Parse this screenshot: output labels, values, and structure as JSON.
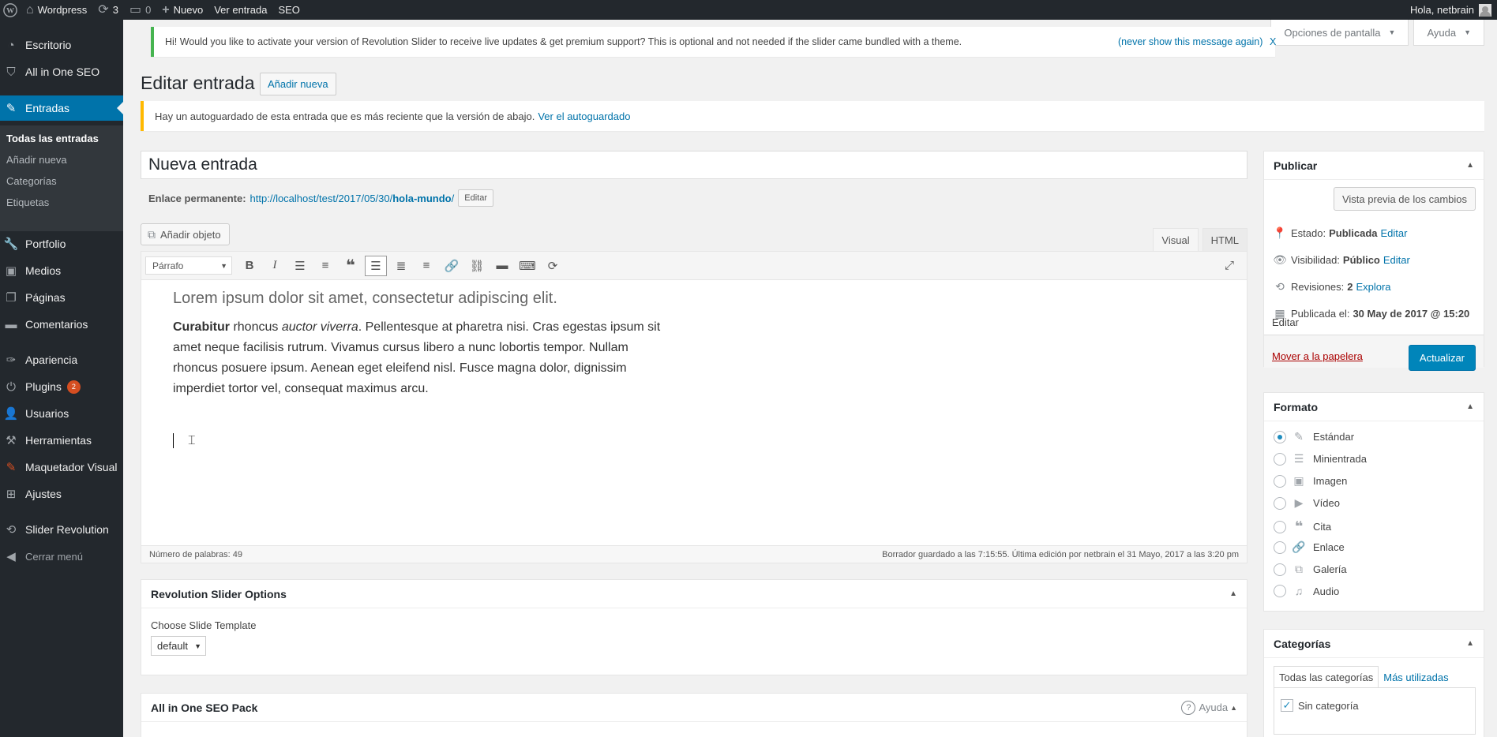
{
  "adminbar": {
    "site_name": "Wordpress",
    "updates_count": "3",
    "comments_count": "0",
    "new_label": "Nuevo",
    "view_post": "Ver entrada",
    "seo": "SEO",
    "greeting": "Hola, netbrain"
  },
  "sidebar": {
    "items": [
      {
        "label": "Escritorio",
        "icon": "dashboard-icon"
      },
      {
        "label": "All in One SEO",
        "icon": "shield-icon"
      },
      {
        "label": "Entradas",
        "icon": "pin-icon"
      },
      {
        "label": "Portfolio",
        "icon": "wrench-icon"
      },
      {
        "label": "Medios",
        "icon": "media-icon"
      },
      {
        "label": "Páginas",
        "icon": "pages-icon"
      },
      {
        "label": "Comentarios",
        "icon": "comment-icon"
      },
      {
        "label": "Apariencia",
        "icon": "brush-icon"
      },
      {
        "label": "Plugins",
        "icon": "plugin-icon",
        "badge": "2"
      },
      {
        "label": "Usuarios",
        "icon": "users-icon"
      },
      {
        "label": "Herramientas",
        "icon": "tools-icon"
      },
      {
        "label": "Maquetador Visual",
        "icon": "builder-icon"
      },
      {
        "label": "Ajustes",
        "icon": "settings-icon"
      },
      {
        "label": "Slider Revolution",
        "icon": "refresh-icon"
      },
      {
        "label": "Cerrar menú",
        "icon": "collapse-icon"
      }
    ],
    "submenu": [
      "Todas las entradas",
      "Añadir nueva",
      "Categorías",
      "Etiquetas"
    ]
  },
  "screen_meta": {
    "options": "Opciones de pantalla",
    "help": "Ayuda"
  },
  "notices": {
    "revslider": "Hi! Would you like to activate your version of Revolution Slider to receive live updates & get premium support? This is optional and not needed if the slider came bundled with a theme.",
    "revslider_dismiss": "(never show this message again)",
    "revslider_x": "X",
    "autosave": "Hay un autoguardado de esta entrada que es más reciente que la versión de abajo.",
    "autosave_link": "Ver el autoguardado"
  },
  "page": {
    "title": "Editar entrada",
    "add_new": "Añadir nueva"
  },
  "post": {
    "title": "Nueva entrada",
    "permalink_label": "Enlace permanente:",
    "permalink_base": "http://localhost/test/2017/05/30/",
    "permalink_slug": "hola-mundo",
    "permalink_end": "/",
    "permalink_edit": "Editar"
  },
  "editor": {
    "add_media": "Añadir objeto",
    "tab_visual": "Visual",
    "tab_html": "HTML",
    "format_value": "Párrafo",
    "heading": "Lorem ipsum dolor sit amet, consectetur adipiscing elit.",
    "para_bold": "Curabitur",
    "para_1": " rhoncus ",
    "para_italic": "auctor viverra",
    "para_2": ". Pellentesque at pharetra nisi. Cras egestas ipsum sit amet neque facilisis rutrum. Vivamus cursus libero a nunc lobortis tempor. Nullam rhoncus posuere ipsum. Aenean eget eleifend nisl. Fusce magna dolor, dignissim imperdiet tortor vel, consequat maximus arcu.",
    "word_count": "Número de palabras: 49",
    "autosave_status": "Borrador guardado a las 7:15:55. Última edición por netbrain el 31 Mayo, 2017 a las 3:20 pm"
  },
  "rev_options": {
    "title": "Revolution Slider Options",
    "choose_label": "Choose Slide Template",
    "template_value": "default"
  },
  "seo_pack": {
    "title": "All in One SEO Pack",
    "help": "Ayuda"
  },
  "publish": {
    "title": "Publicar",
    "preview": "Vista previa de los cambios",
    "status_label": "Estado:",
    "status_value": "Publicada",
    "visibility_label": "Visibilidad:",
    "visibility_value": "Público",
    "revisions_label": "Revisiones:",
    "revisions_value": "2",
    "revisions_link": "Explora",
    "published_label": "Publicada el:",
    "published_value": "30 May de 2017 @ 15:20",
    "edit": "Editar",
    "trash": "Mover a la papelera",
    "update": "Actualizar"
  },
  "formato": {
    "title": "Formato",
    "options": [
      {
        "label": "Estándar",
        "icon": "pin-icon",
        "checked": true
      },
      {
        "label": "Minientrada",
        "icon": "aside-icon",
        "checked": false
      },
      {
        "label": "Imagen",
        "icon": "image-icon",
        "checked": false
      },
      {
        "label": "Vídeo",
        "icon": "video-icon",
        "checked": false
      },
      {
        "label": "Cita",
        "icon": "quote-icon",
        "checked": false
      },
      {
        "label": "Enlace",
        "icon": "link-icon",
        "checked": false
      },
      {
        "label": "Galería",
        "icon": "gallery-icon",
        "checked": false
      },
      {
        "label": "Audio",
        "icon": "audio-icon",
        "checked": false
      }
    ]
  },
  "categorias": {
    "title": "Categorías",
    "tab_all": "Todas las categorías",
    "tab_popular": "Más utilizadas",
    "item": "Sin categoría"
  }
}
